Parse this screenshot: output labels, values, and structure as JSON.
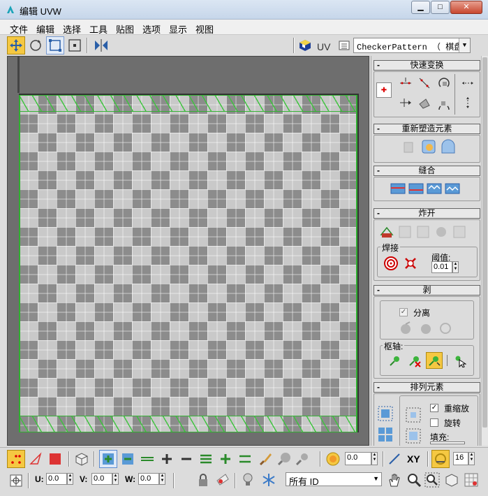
{
  "window": {
    "title": "编辑 UVW",
    "minimize": "▁",
    "maximize": "□",
    "close": "✕"
  },
  "menu": [
    "文件",
    "编辑",
    "选择",
    "工具",
    "贴图",
    "选项",
    "显示",
    "视图"
  ],
  "toolbar": {
    "uv_label": "UV",
    "texture_select": "CheckerPattern （ 棋盘"
  },
  "panel": {
    "quick_transform": {
      "title": "快速变换"
    },
    "reshape": {
      "title": "重新塑造元素"
    },
    "stitch": {
      "title": "缝合"
    },
    "explode": {
      "title": "炸开",
      "weld_label": "焊接",
      "threshold_label": "阈值:",
      "threshold_value": "0.01"
    },
    "peel": {
      "title": "剥",
      "detach_label": "分离",
      "pivot_label": "枢轴:"
    },
    "arrange": {
      "title": "排列元素",
      "rescale_label": "重缩放",
      "rotate_label": "旋转",
      "padding_label": "填充:"
    }
  },
  "bottom": {
    "soft_value": "0.0",
    "xy_label": "XY",
    "grid_value": "16",
    "u_label": "U:",
    "u_value": "0.0",
    "v_label": "V:",
    "v_value": "0.0",
    "w_label": "W:",
    "w_value": "0.0",
    "filter_select": "所有 ID"
  }
}
